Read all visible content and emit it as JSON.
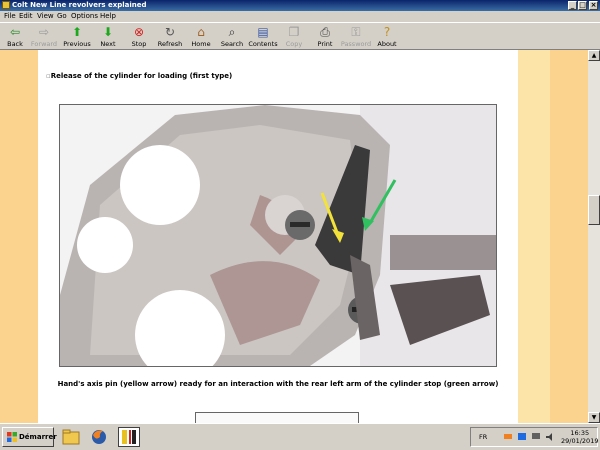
{
  "window": {
    "title": "Colt New Line revolvers explained"
  },
  "menu": [
    "File",
    "Edit",
    "View",
    "Go",
    "Options",
    "Help"
  ],
  "toolbar": {
    "back": "Back",
    "forward": "Forward",
    "previous": "Previous",
    "next": "Next",
    "stop": "Stop",
    "refresh": "Refresh",
    "home": "Home",
    "search": "Search",
    "contents": "Contents",
    "copy": "Copy",
    "print": "Print",
    "password": "Password",
    "about": "About"
  },
  "content": {
    "heading": "Release of the cylinder for loading (first type)",
    "caption": "Hand's axis pin (yellow arrow) ready for an interaction with the rear left arm of the cylinder stop (green arrow)"
  },
  "taskbar": {
    "start_label": "Démarrer",
    "language": "FR",
    "time": "16:35",
    "date": "29/01/2019"
  },
  "colors": {
    "titlebar": "#0a246a",
    "band_left": "#fcd38e",
    "band_right": "#fce4a8",
    "arrow_yellow": "#f2e23a",
    "arrow_green": "#30c060"
  }
}
